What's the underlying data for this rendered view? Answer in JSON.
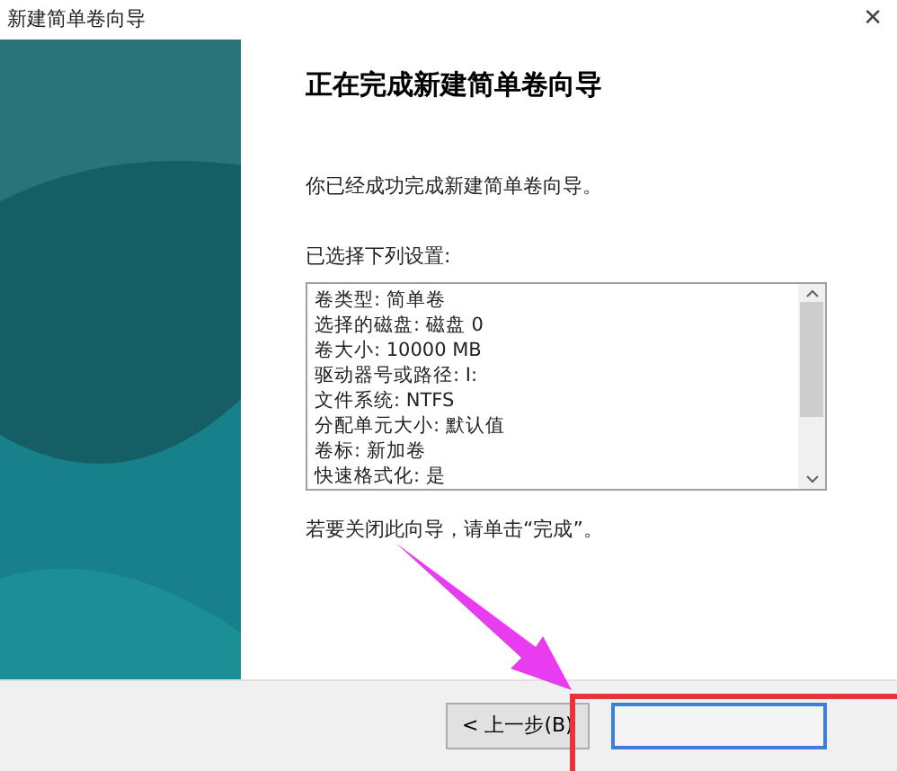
{
  "window": {
    "title": "新建简单卷向导",
    "close": "✕"
  },
  "heading": "正在完成新建简单卷向导",
  "message": "你已经成功完成新建简单卷向导。",
  "settings_label": "已选择下列设置:",
  "settings": [
    "卷类型: 简单卷",
    "选择的磁盘: 磁盘 0",
    "卷大小: 10000 MB",
    "驱动器号或路径: I:",
    "文件系统: NTFS",
    "分配单元大小: 默认值",
    "卷标: 新加卷",
    "快速格式化: 是"
  ],
  "close_hint": "若要关闭此向导，请单击“完成”。",
  "buttons": [
    {
      "label": "< 上一步(B)",
      "kind": "normal"
    },
    {
      "kind": "default"
    }
  ]
}
